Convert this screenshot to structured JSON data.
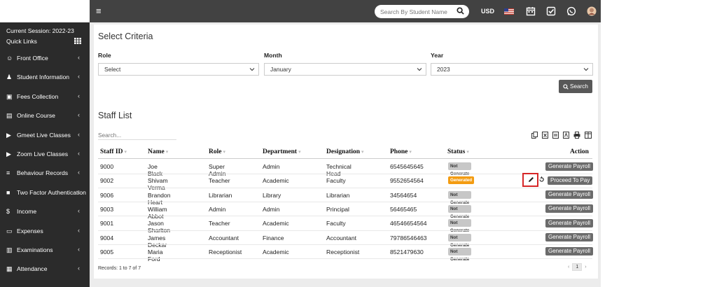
{
  "topbar": {
    "search_placeholder": "Search By Student Name",
    "currency": "USD",
    "icons": [
      "menu-icon",
      "search-icon",
      "flag-icon",
      "calendar-icon",
      "checkbox-icon",
      "whatsapp-icon",
      "avatar"
    ]
  },
  "sidebar": {
    "session": "Current Session: 2022-23",
    "quick_links": "Quick Links",
    "items": [
      {
        "label": "Front Office",
        "icon": "front-office-icon"
      },
      {
        "label": "Student Information",
        "icon": "student-icon"
      },
      {
        "label": "Fees Collection",
        "icon": "money-icon"
      },
      {
        "label": "Online Course",
        "icon": "course-icon"
      },
      {
        "label": "Gmeet Live Classes",
        "icon": "video-icon"
      },
      {
        "label": "Zoom Live Classes",
        "icon": "video-icon"
      },
      {
        "label": "Behaviour Records",
        "icon": "behaviour-icon"
      },
      {
        "label": "Two Factor Authentication",
        "icon": "lock-icon"
      },
      {
        "label": "Income",
        "icon": "dollar-icon"
      },
      {
        "label": "Expenses",
        "icon": "credit-card-icon"
      },
      {
        "label": "Examinations",
        "icon": "map-icon"
      },
      {
        "label": "Attendance",
        "icon": "calendar-check-icon"
      }
    ],
    "chevron": "‹"
  },
  "criteria": {
    "title": "Select Criteria",
    "role_label": "Role",
    "role_value": "Select",
    "month_label": "Month",
    "month_value": "January",
    "year_label": "Year",
    "year_value": "2023",
    "search_button": "Search"
  },
  "staff": {
    "title": "Staff List",
    "search_placeholder": "Search...",
    "columns": [
      "Staff ID",
      "Name",
      "Role",
      "Department",
      "Designation",
      "Phone",
      "Status",
      "Action"
    ],
    "rows": [
      {
        "id": "9000",
        "name": "Joe Black",
        "role": "Super Admin",
        "dept": "Admin",
        "desig": "Technical Head",
        "phone": "6545645645",
        "status": "Not Generate",
        "action": "Generate Payroll"
      },
      {
        "id": "9002",
        "name": "Shivam Verma",
        "role": "Teacher",
        "dept": "Academic",
        "desig": "Faculty",
        "phone": "9552654564",
        "status": "Generated",
        "action": "Proceed To Pay"
      },
      {
        "id": "9006",
        "name": "Brandon Heart",
        "role": "Librarian",
        "dept": "Library",
        "desig": "Librarian",
        "phone": "34564654",
        "status": "Not Generate",
        "action": "Generate Payroll"
      },
      {
        "id": "9003",
        "name": "William Abbot",
        "role": "Admin",
        "dept": "Admin",
        "desig": "Principal",
        "phone": "56465465",
        "status": "Not Generate",
        "action": "Generate Payroll"
      },
      {
        "id": "9001",
        "name": "Jason Sharlton",
        "role": "Teacher",
        "dept": "Academic",
        "desig": "Faculty",
        "phone": "46546654564",
        "status": "Not Generate",
        "action": "Generate Payroll"
      },
      {
        "id": "9004",
        "name": "James Deckar",
        "role": "Accountant",
        "dept": "Finance",
        "desig": "Accountant",
        "phone": "79786546463",
        "status": "Not Generate",
        "action": "Generate Payroll"
      },
      {
        "id": "9005",
        "name": "Maria Ford",
        "role": "Receptionist",
        "dept": "Academic",
        "desig": "Receptionist",
        "phone": "8521479630",
        "status": "Not Generate",
        "action": "Generate Payroll"
      }
    ],
    "records": "Records: 1 to 7 of 7",
    "page": "1",
    "prev": "‹",
    "next": "›"
  },
  "colors": {
    "topbar": "#424242",
    "sidebar": "#2b2b2b",
    "generated": "#f39c12",
    "highlight": "#d62728"
  }
}
